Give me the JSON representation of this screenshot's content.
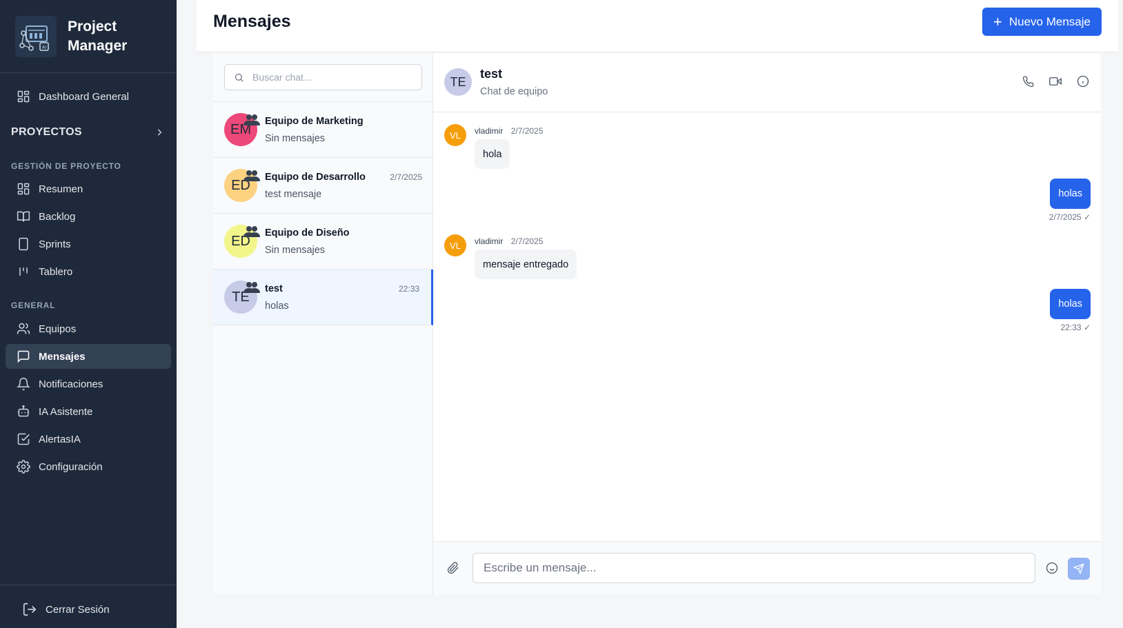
{
  "app": {
    "title_line1": "Project",
    "title_line2": "Manager"
  },
  "sidebar": {
    "top_item": {
      "label": "Dashboard General",
      "icon": "grid-icon"
    },
    "projects_label": "PROYECTOS",
    "project_section_label": "GESTIÓN DE PROYECTO",
    "project_items": [
      {
        "label": "Resumen",
        "icon": "grid-icon"
      },
      {
        "label": "Backlog",
        "icon": "book-icon"
      },
      {
        "label": "Sprints",
        "icon": "tablet-icon"
      },
      {
        "label": "Tablero",
        "icon": "kanban-icon"
      }
    ],
    "general_section_label": "GENERAL",
    "general_items": [
      {
        "label": "Equipos",
        "icon": "users-icon"
      },
      {
        "label": "Mensajes",
        "icon": "chat-icon",
        "active": true
      },
      {
        "label": "Notificaciones",
        "icon": "bell-icon"
      },
      {
        "label": "IA Asistente",
        "icon": "bot-icon"
      },
      {
        "label": "AlertasIA",
        "icon": "check-square-icon"
      },
      {
        "label": "Configuración",
        "icon": "gear-icon"
      }
    ],
    "logout_label": "Cerrar Sesión"
  },
  "header": {
    "title": "Mensajes",
    "new_button": "Nuevo Mensaje"
  },
  "chatlist": {
    "search_placeholder": "Buscar chat...",
    "chats": [
      {
        "initials": "EM",
        "name": "Equipo de Marketing",
        "preview": "Sin mensajes",
        "time": "",
        "color": "#ec4879"
      },
      {
        "initials": "ED",
        "name": "Equipo de Desarrollo",
        "preview": "test mensaje",
        "time": "2/7/2025",
        "color": "#fcd180"
      },
      {
        "initials": "ED",
        "name": "Equipo de Diseño",
        "preview": "Sin mensajes",
        "time": "",
        "color": "#f2f58a"
      },
      {
        "initials": "TE",
        "name": "test",
        "preview": "holas",
        "time": "22:33",
        "color": "#c7cbe8",
        "active": true
      }
    ]
  },
  "conversation": {
    "initials": "TE",
    "name": "test",
    "subtitle": "Chat de equipo",
    "messages": [
      {
        "direction": "in",
        "initials": "VL",
        "author": "vladimir",
        "time": "2/7/2025",
        "text": "hola"
      },
      {
        "direction": "out",
        "time": "2/7/2025",
        "status": "✓",
        "text": "holas"
      },
      {
        "direction": "in",
        "initials": "VL",
        "author": "vladimir",
        "time": "2/7/2025",
        "text": "mensaje entregado"
      },
      {
        "direction": "out",
        "time": "22:33",
        "status": "✓",
        "text": "holas"
      }
    ],
    "composer_placeholder": "Escribe un mensaje..."
  },
  "colors": {
    "sidebar_bg": "#1e293b",
    "accent": "#2563eb",
    "incoming_avatar": "#f59e0b"
  }
}
